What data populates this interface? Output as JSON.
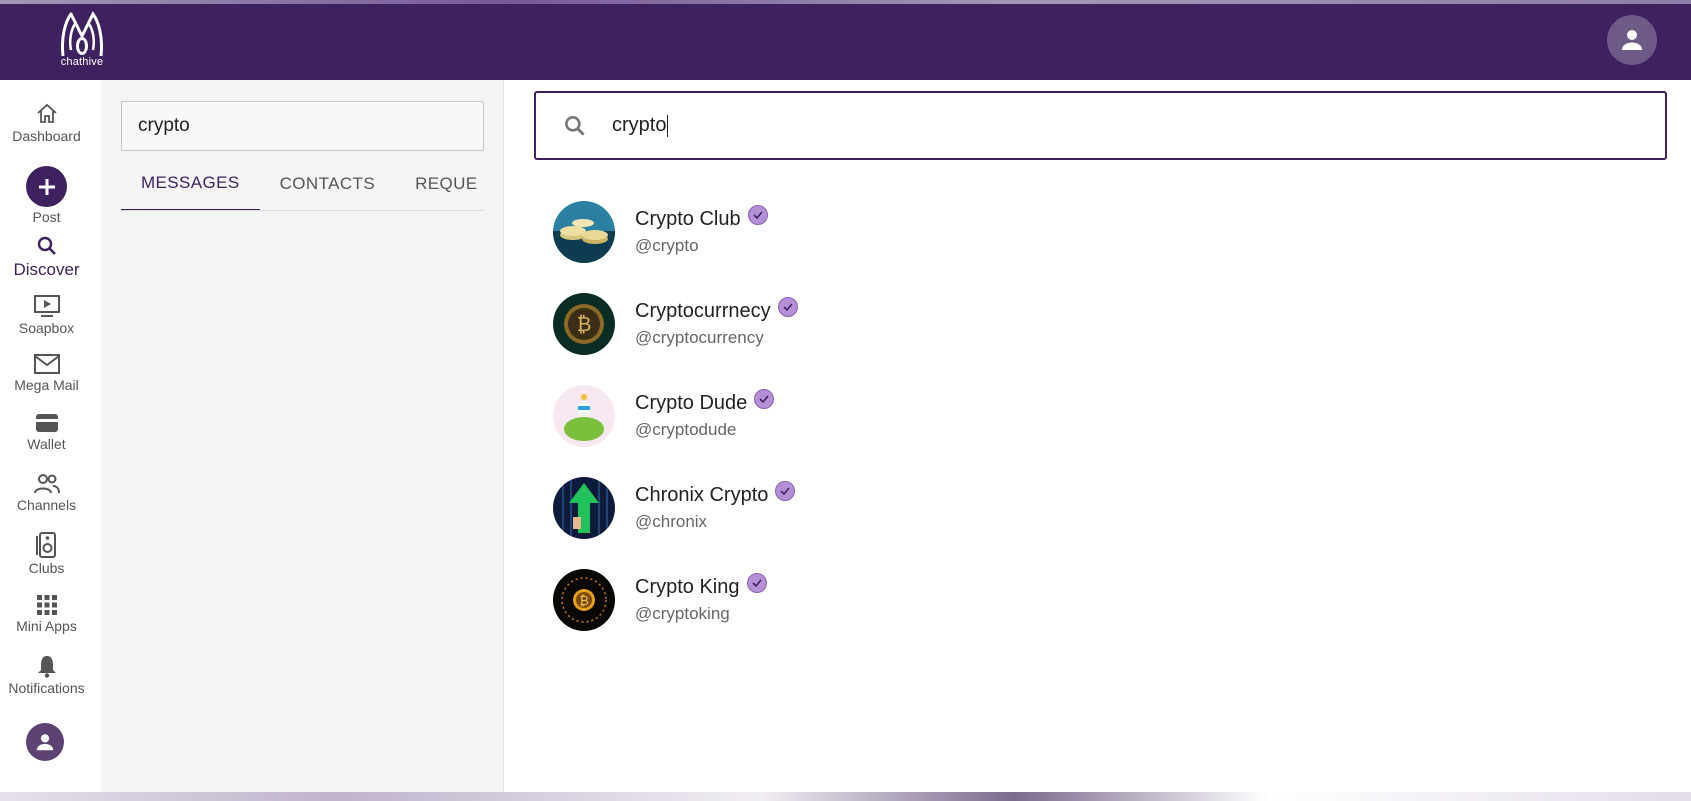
{
  "app": {
    "logo_text": "chathive"
  },
  "nav": {
    "items": [
      {
        "label": "Dashboard",
        "icon": "home-icon"
      },
      {
        "label": "Post",
        "icon": "plus-icon"
      },
      {
        "label": "Discover",
        "icon": "search-icon",
        "active": true
      },
      {
        "label": "Soapbox",
        "icon": "play-screen-icon"
      },
      {
        "label": "Mega Mail",
        "icon": "mail-icon"
      },
      {
        "label": "Wallet",
        "icon": "wallet-icon"
      },
      {
        "label": "Channels",
        "icon": "people-icon"
      },
      {
        "label": "Clubs",
        "icon": "speaker-icon"
      },
      {
        "label": "Mini Apps",
        "icon": "grid-icon"
      },
      {
        "label": "Notifications",
        "icon": "bell-icon"
      }
    ]
  },
  "messages_panel": {
    "search_value": "crypto",
    "tabs": [
      {
        "label": "MESSAGES",
        "active": true
      },
      {
        "label": "CONTACTS"
      },
      {
        "label": "REQUE"
      }
    ]
  },
  "discover": {
    "search_value": "crypto",
    "results": [
      {
        "name": "Crypto Club",
        "handle": "@crypto",
        "verified": true
      },
      {
        "name": "Cryptocurrnecy",
        "handle": "@cryptocurrency",
        "verified": true
      },
      {
        "name": "Crypto Dude",
        "handle": "@cryptodude",
        "verified": true
      },
      {
        "name": "Chronix Crypto",
        "handle": "@chronix",
        "verified": true
      },
      {
        "name": "Crypto King",
        "handle": "@cryptoking",
        "verified": true
      }
    ]
  },
  "colors": {
    "brand": "#3e2260",
    "badge": "#b48fd6"
  }
}
